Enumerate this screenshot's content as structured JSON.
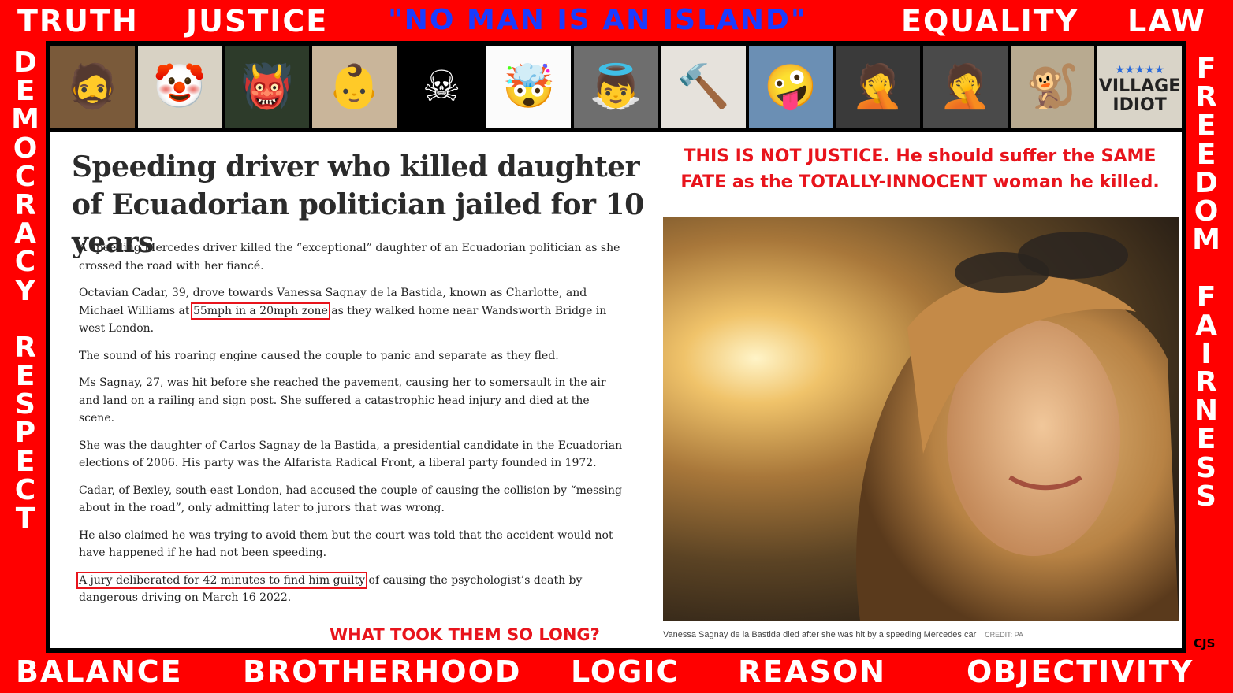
{
  "frame": {
    "top": [
      "TRUTH",
      "JUSTICE",
      "\"NO MAN IS AN ISLAND\"",
      "EQUALITY",
      "LAW"
    ],
    "bottom": [
      "BALANCE",
      "BROTHERHOOD",
      "LOGIC",
      "REASON",
      "OBJECTIVITY"
    ],
    "left": [
      "D",
      "E",
      "M",
      "O",
      "C",
      "R",
      "A",
      "C",
      "Y",
      "",
      "R",
      "E",
      "S",
      "P",
      "E",
      "C",
      "T"
    ],
    "right": [
      "F",
      "R",
      "E",
      "E",
      "D",
      "O",
      "M",
      "",
      "F",
      "A",
      "I",
      "R",
      "N",
      "E",
      "S",
      "S"
    ],
    "signature": "CJS"
  },
  "strip": {
    "tiles": [
      {
        "icon": "man-with-pipe-icon",
        "glyph": "🧔"
      },
      {
        "icon": "clown-mask-icon",
        "glyph": "🤡"
      },
      {
        "icon": "monster-face-icon",
        "glyph": "👹"
      },
      {
        "icon": "baby-facepalm-icon",
        "glyph": "👶"
      },
      {
        "icon": "skull-crossbones-icon",
        "glyph": "☠"
      },
      {
        "icon": "exploding-head-icon",
        "glyph": "🤯"
      },
      {
        "icon": "weeping-angel-icon",
        "glyph": "👼"
      },
      {
        "icon": "caricature-hammer-icon",
        "glyph": "🔨"
      },
      {
        "icon": "caricature-face-icon",
        "glyph": "🤪"
      },
      {
        "icon": "facepalm-man-icon",
        "glyph": "🤦"
      },
      {
        "icon": "facepalm-man-2-icon",
        "glyph": "🤦"
      },
      {
        "icon": "monkey-icon",
        "glyph": "🐒"
      },
      {
        "icon": "village-idiot-sign-icon",
        "text": "VILLAGE\nIDIOT"
      }
    ]
  },
  "headline": "Speeding driver who killed daughter of Ecuadorian politician jailed for 10 years",
  "comment": "THIS IS NOT JUSTICE. He should suffer the SAME FATE as the TOTALLY-INNOCENT woman he killed.",
  "article": {
    "p1": "A speeding Mercedes driver killed the “exceptional” daughter of an Ecuadorian politician as she crossed the road with her fiancé.",
    "p2_a": "Octavian Cadar, 39, drove towards Vanessa Sagnay de la Bastida, known as Charlotte, and Michael Williams at ",
    "p2_hl": "55mph in a 20mph zone",
    "p2_b": " as they walked home near Wandsworth Bridge in west London.",
    "p3": "The sound of his roaring engine caused the couple to panic and separate as they fled.",
    "p4": "Ms Sagnay, 27, was hit before she reached the pavement, causing her to somersault in the air and land on a railing and sign post. She suffered a catastrophic head injury and died at the scene.",
    "p5": "She was the daughter of Carlos Sagnay de la Bastida, a presidential candidate in the Ecuadorian elections of 2006. His party was the Alfarista Radical Front, a liberal party founded in 1972.",
    "p6": "Cadar, of Bexley, south-east London, had accused the couple of causing the collision by “messing about in the road”, only admitting later to jurors that was wrong.",
    "p7": "He also claimed he was trying to avoid them but the court was told that the accident would not have happened if he had not been speeding.",
    "p8_hl": "A jury deliberated for 42 minutes to find him guilty",
    "p8_b": " of causing the psychologist’s death by dangerous driving on March 16 2022."
  },
  "took": "WHAT TOOK THEM SO LONG?",
  "caption": {
    "text": "Vanessa Sagnay de la Bastida died after she was hit by a speeding Mercedes car",
    "credit": "| CREDIT: PA"
  },
  "colors": {
    "frame": "#ff0000",
    "accent_text": "#e8141c",
    "blue": "#1a3cff"
  }
}
